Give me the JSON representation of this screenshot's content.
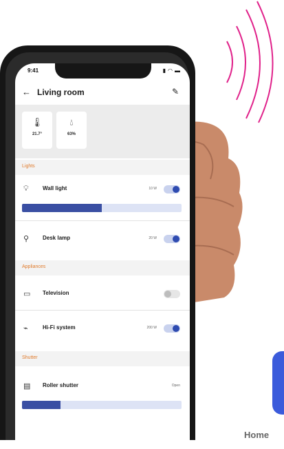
{
  "status_bar": {
    "time": "9:41"
  },
  "header": {
    "title": "Living room"
  },
  "sensors": [
    {
      "icon": "thermometer-icon",
      "value": "21.7°"
    },
    {
      "icon": "droplet-icon",
      "value": "63%"
    }
  ],
  "sections": {
    "lights": "Lights",
    "appliances": "Appliances",
    "shutter": "Shutter"
  },
  "devices": {
    "wall_light": {
      "name": "Wall light",
      "power": "10 W",
      "on": true,
      "level": 0.5
    },
    "desk_lamp": {
      "name": "Desk lamp",
      "power": "20 W",
      "on": true
    },
    "television": {
      "name": "Television",
      "on": false
    },
    "hifi": {
      "name": "Hi-Fi system",
      "power": "200 W",
      "on": true
    },
    "roller_shutter": {
      "name": "Roller shutter",
      "state": "Open",
      "level": 0.24
    }
  },
  "footer": {
    "home_label": "Home"
  },
  "colors": {
    "accent": "#2e4bb0",
    "section_label": "#e07a2a",
    "waves": "#e0218a"
  }
}
